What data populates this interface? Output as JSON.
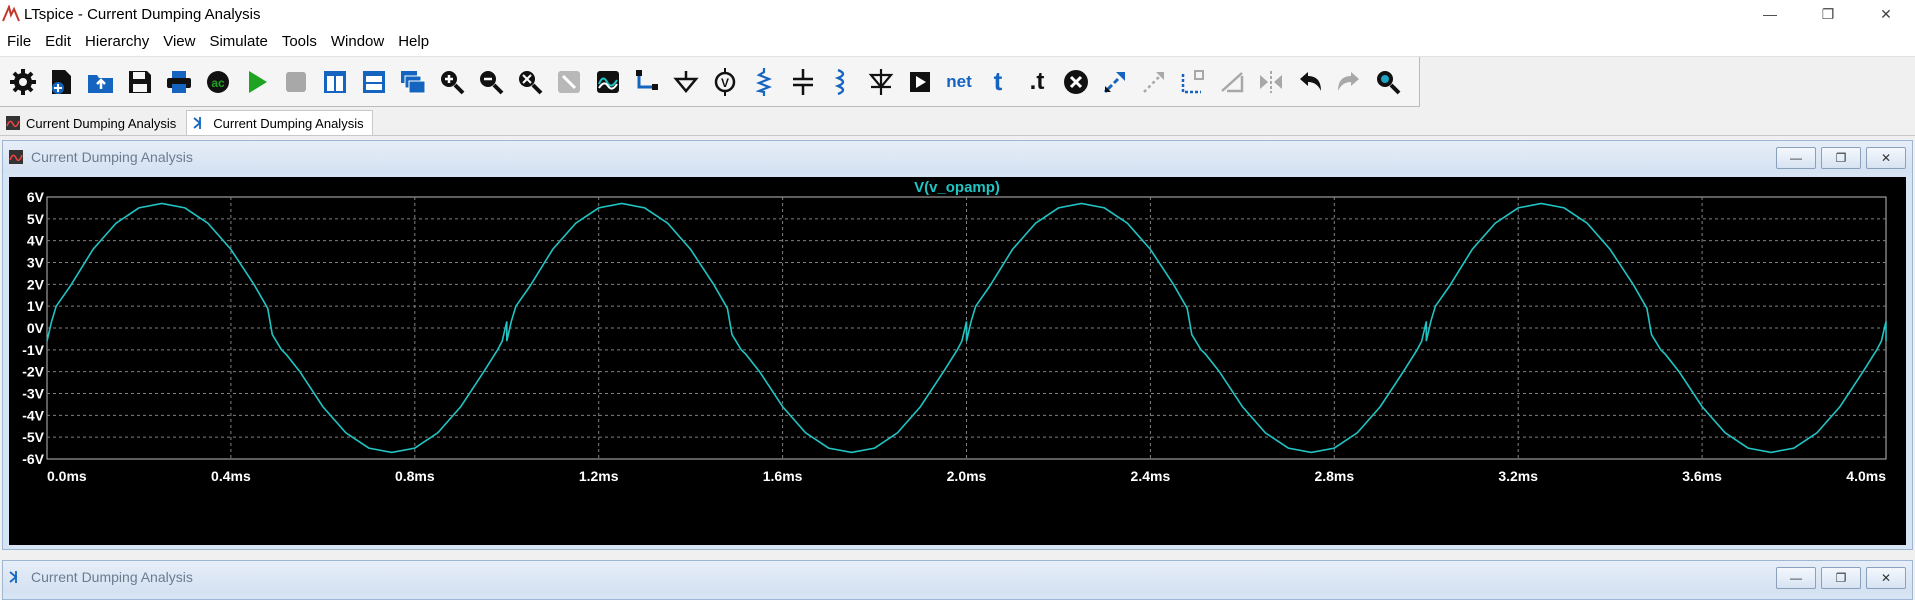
{
  "window": {
    "title": "LTspice - Current Dumping Analysis",
    "controls": [
      "—",
      "❐",
      "✕"
    ]
  },
  "menu": [
    "File",
    "Edit",
    "Hierarchy",
    "View",
    "Simulate",
    "Tools",
    "Window",
    "Help"
  ],
  "toolbar_icons": [
    "settings-icon",
    "new-schematic-icon",
    "open-icon",
    "save-icon",
    "print-icon",
    "ac-icon",
    "run-icon",
    "halt-icon",
    "tile-vertical-icon",
    "tile-horizontal-icon",
    "cascade-icon",
    "zoom-in-icon",
    "zoom-out-icon",
    "zoom-fit-icon",
    "zoom-full-icon",
    "waveform-icon",
    "wire-icon",
    "ground-icon",
    "voltage-source-icon",
    "resistor-icon",
    "capacitor-icon",
    "inductor-icon",
    "diode-icon",
    "component-icon",
    "net-label-icon",
    "text-icon",
    "spice-directive-icon",
    "delete-icon",
    "move-icon",
    "drag-icon",
    "rotate-icon",
    "mirror-icon",
    "mirror2-icon",
    "undo-icon",
    "redo-icon",
    "find-icon"
  ],
  "toolbar_labels": {
    "ac": "ac",
    "net": "net",
    "text": "t",
    "spice": ".t"
  },
  "tabs": [
    {
      "label": "Current Dumping Analysis",
      "icon": "waveform-tab-icon"
    },
    {
      "label": "Current Dumping Analysis",
      "icon": "schematic-tab-icon"
    }
  ],
  "plot_window": {
    "title": "Current Dumping Analysis"
  },
  "schematic_window": {
    "title": "Current Dumping Analysis"
  },
  "mdi_buttons": [
    "—",
    "❐",
    "✕"
  ],
  "colors": {
    "trace": "#21c3c3",
    "grid": "#808080",
    "axis_text": "#ffffff",
    "background": "#000000"
  },
  "chart_data": {
    "type": "line",
    "title": "V(v_opamp)",
    "xlabel": "",
    "ylabel": "",
    "xlim": [
      0,
      4
    ],
    "ylim": [
      -6,
      6
    ],
    "x_unit": "ms",
    "y_unit": "V",
    "x_ticks": [
      "0.0ms",
      "0.4ms",
      "0.8ms",
      "1.2ms",
      "1.6ms",
      "2.0ms",
      "2.4ms",
      "2.8ms",
      "3.2ms",
      "3.6ms",
      "4.0ms"
    ],
    "y_ticks": [
      "6V",
      "5V",
      "4V",
      "3V",
      "2V",
      "1V",
      "0V",
      "-1V",
      "-2V",
      "-3V",
      "-4V",
      "-5V",
      "-6V"
    ],
    "series": [
      {
        "name": "V(v_opamp)",
        "color": "#21c3c3",
        "x": [
          0.0,
          0.01,
          0.02,
          0.05,
          0.1,
          0.15,
          0.2,
          0.25,
          0.3,
          0.35,
          0.4,
          0.45,
          0.48,
          0.49,
          0.51,
          0.52,
          0.55,
          0.6,
          0.65,
          0.7,
          0.75,
          0.8,
          0.85,
          0.9,
          0.95,
          0.98,
          0.99,
          1.0
        ],
        "y": [
          -0.6,
          0.3,
          1.0,
          1.9,
          3.6,
          4.8,
          5.5,
          5.7,
          5.5,
          4.8,
          3.6,
          2.0,
          0.9,
          -0.3,
          -1.0,
          -1.2,
          -2.0,
          -3.6,
          -4.8,
          -5.5,
          -5.7,
          -5.5,
          -4.8,
          -3.6,
          -2.0,
          -1.0,
          -0.6,
          0.3
        ]
      }
    ],
    "period_ms": 1.0,
    "grid": true,
    "legend": "top-center"
  }
}
